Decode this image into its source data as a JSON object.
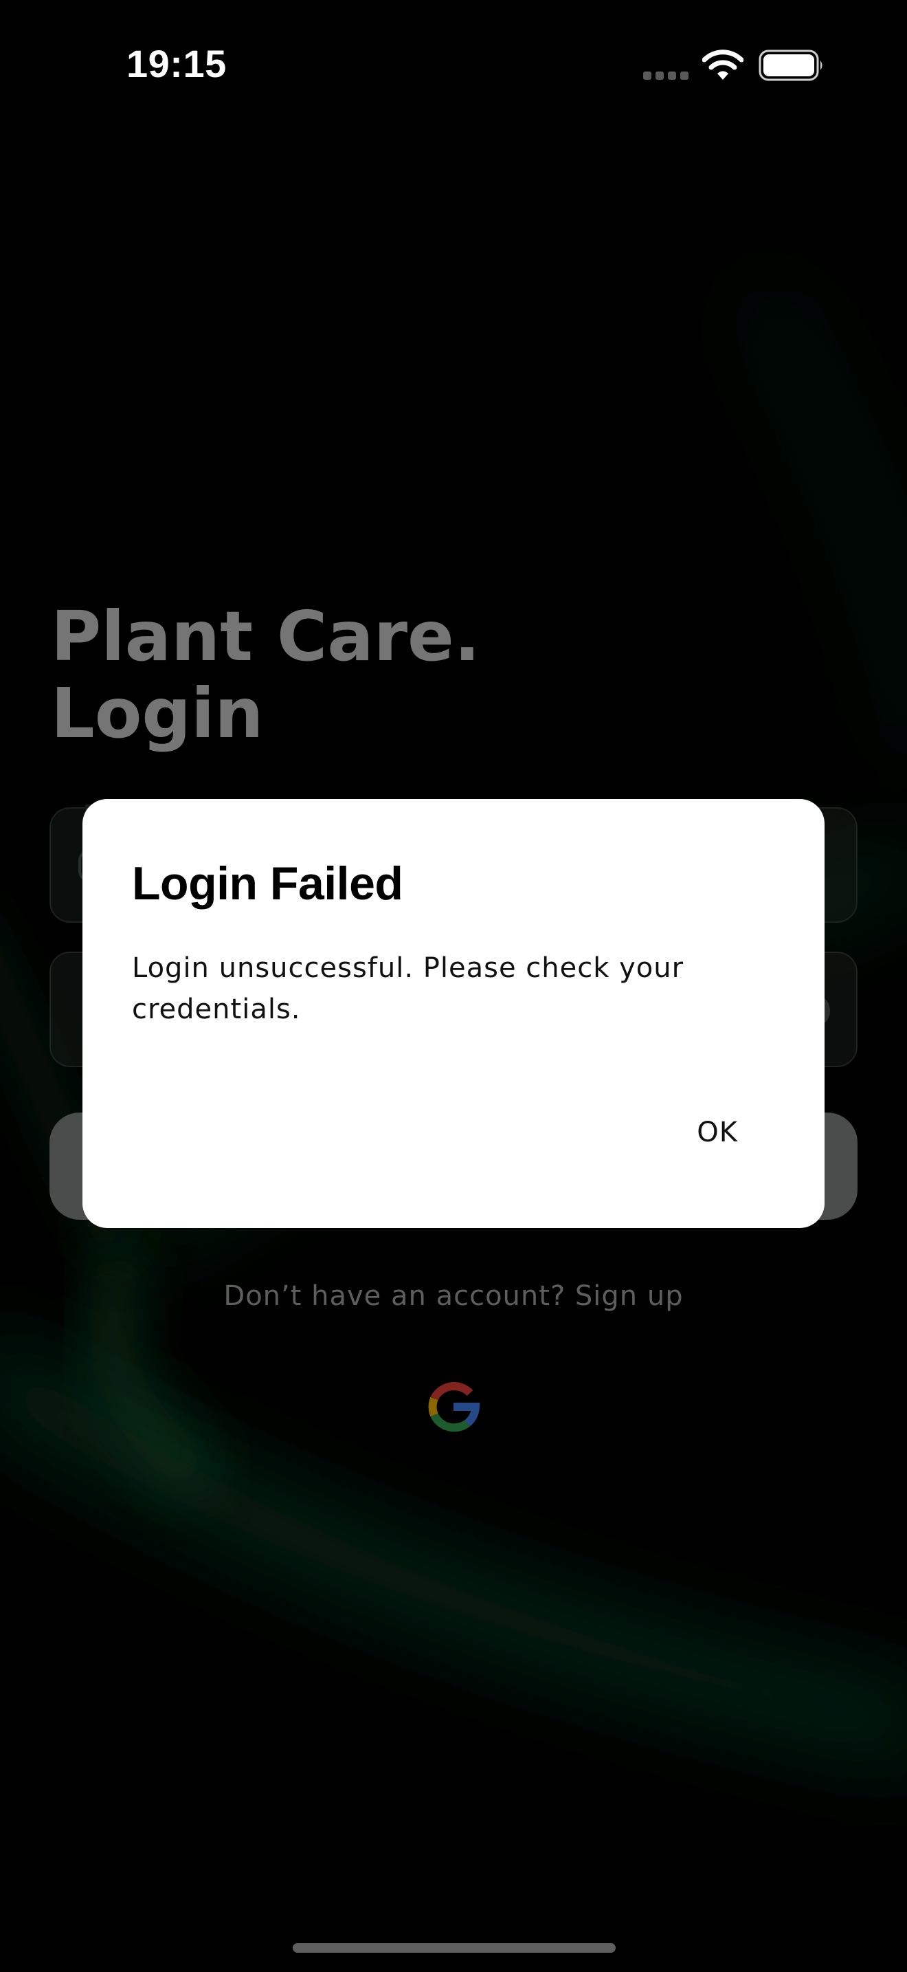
{
  "status_bar": {
    "time": "19:15",
    "signal_icon": "cellular-signal-icon",
    "wifi_icon": "wifi-icon",
    "battery_icon": "battery-icon"
  },
  "login_screen": {
    "title_line1": "Plant Care.",
    "title_line2": "Login",
    "signup_prompt": "Don’t have an account? Sign up",
    "google_icon": "google-logo-icon"
  },
  "dialog": {
    "title": "Login Failed",
    "message": "Login unsuccessful. Please check your credentials.",
    "ok_label": "OK"
  },
  "colors": {
    "background": "#000000",
    "accent_glow": "#0f3a22",
    "dialog_background": "#ffffff",
    "dimmed_text": "#757575"
  }
}
